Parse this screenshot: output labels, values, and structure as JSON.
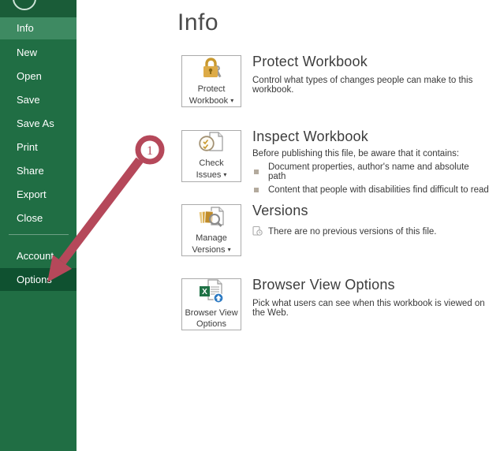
{
  "colors": {
    "sidebar_green": "#206e44",
    "sidebar_top_green": "#1a5c38",
    "active_item_green": "#3e8a62",
    "highlight_item_green": "#0f5130",
    "annotation_red": "#b5485a",
    "excel_logo_green": "#1e7145"
  },
  "sidebar": {
    "items": [
      {
        "label": "Info",
        "state": "active"
      },
      {
        "label": "New",
        "state": "normal"
      },
      {
        "label": "Open",
        "state": "normal"
      },
      {
        "label": "Save",
        "state": "normal"
      },
      {
        "label": "Save As",
        "state": "normal"
      },
      {
        "label": "Print",
        "state": "normal"
      },
      {
        "label": "Share",
        "state": "normal"
      },
      {
        "label": "Export",
        "state": "normal"
      },
      {
        "label": "Close",
        "state": "normal"
      },
      {
        "label": "Account",
        "state": "normal"
      },
      {
        "label": "Options",
        "state": "highlighted"
      }
    ]
  },
  "page": {
    "title": "Info"
  },
  "sections": [
    {
      "button": {
        "line1": "Protect",
        "line2": "Workbook",
        "caret": "▾",
        "icon": "lock-icon"
      },
      "heading": "Protect Workbook",
      "description": "Control what types of changes people can make to this workbook."
    },
    {
      "button": {
        "line1": "Check",
        "line2": "Issues",
        "caret": "▾",
        "icon": "inspect-icon"
      },
      "heading": "Inspect Workbook",
      "description": "Before publishing this file, be aware that it contains:",
      "bullets": [
        "Document properties, author's name and absolute path",
        "Content that people with disabilities find difficult to read"
      ]
    },
    {
      "button": {
        "line1": "Manage",
        "line2": "Versions",
        "caret": "▾",
        "icon": "versions-icon"
      },
      "heading": "Versions",
      "status": "There are no previous versions of this file."
    },
    {
      "button": {
        "line1": "Browser View",
        "line2": "Options",
        "caret": "",
        "icon": "browser-view-icon"
      },
      "heading": "Browser View Options",
      "description": "Pick what users can see when this workbook is viewed on the Web."
    }
  ],
  "annotation": {
    "badge": "1"
  }
}
